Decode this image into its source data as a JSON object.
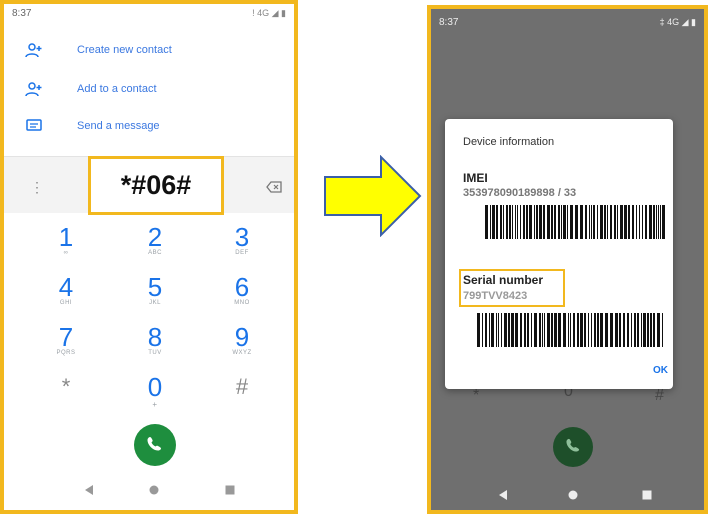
{
  "left_screen": {
    "status_time": "8:37",
    "status_icons": "! 4G ◢ ▮",
    "actions": [
      {
        "label": "Create new contact",
        "icon": "person-add-icon"
      },
      {
        "label": "Add to a contact",
        "icon": "person-add-icon"
      },
      {
        "label": "Send a message",
        "icon": "message-icon"
      }
    ],
    "entered_code": "*#06#",
    "keypad": [
      {
        "digit": "1",
        "letters": "∞"
      },
      {
        "digit": "2",
        "letters": "ABC"
      },
      {
        "digit": "3",
        "letters": "DEF"
      },
      {
        "digit": "4",
        "letters": "GHI"
      },
      {
        "digit": "5",
        "letters": "JKL"
      },
      {
        "digit": "6",
        "letters": "MNO"
      },
      {
        "digit": "7",
        "letters": "PQRS"
      },
      {
        "digit": "8",
        "letters": "TUV"
      },
      {
        "digit": "9",
        "letters": "WXYZ"
      },
      {
        "digit": "*",
        "letters": ""
      },
      {
        "digit": "0",
        "letters": "+"
      },
      {
        "digit": "#",
        "letters": ""
      }
    ]
  },
  "right_screen": {
    "status_time": "8:37",
    "status_icons": "‡ 4G ◢ ▮",
    "dialog": {
      "title": "Device information",
      "imei_label": "IMEI",
      "imei_value": "353978090189898  /  33",
      "serial_label": "Serial number",
      "serial_value": "799TVV8423",
      "ok_label": "OK"
    }
  },
  "colors": {
    "highlight": "#f2b81e",
    "arrow_fill": "#ffff00",
    "accent": "#1a73e8",
    "call_green": "#1e8e3e"
  }
}
